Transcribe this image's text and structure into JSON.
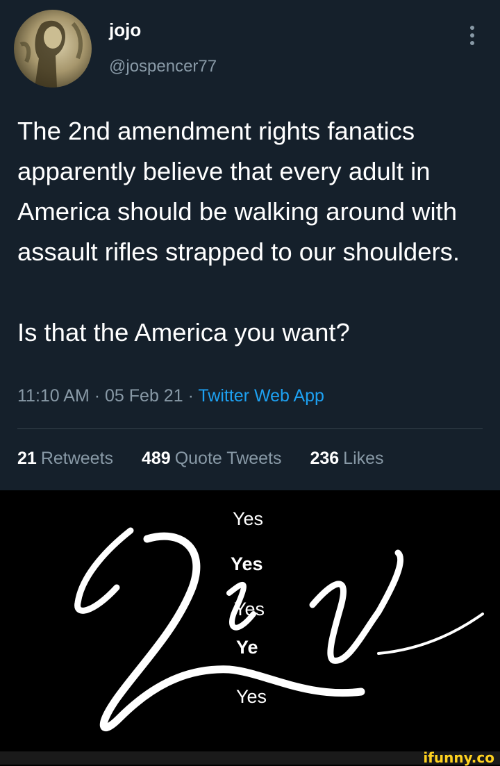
{
  "tweet": {
    "display_name": "jojo",
    "handle": "@jospencer77",
    "text": "The 2nd amendment rights fanatics apparently believe that every adult in America should be walking around with assault rifles strapped to our shoulders.\n\nIs that the America you want?",
    "time": "11:10 AM",
    "date": "05 Feb 21",
    "separator": "·",
    "source": "Twitter Web App",
    "stats": [
      {
        "count": "21",
        "label": "Retweets"
      },
      {
        "count": "489",
        "label": "Quote Tweets"
      },
      {
        "count": "236",
        "label": "Likes"
      }
    ]
  },
  "reply": {
    "yes_list": [
      "Yes",
      "Yes",
      "Yes",
      "Ye",
      "Yes"
    ],
    "script_word": "Yes"
  },
  "watermark": "ifunny.co",
  "colors": {
    "tweet_bg": "#15202b",
    "text": "#ffffff",
    "muted": "#8899a6",
    "link": "#1da1f2",
    "watermark": "#ffd21f"
  },
  "icons": {
    "more": "vertical-ellipsis-icon"
  }
}
